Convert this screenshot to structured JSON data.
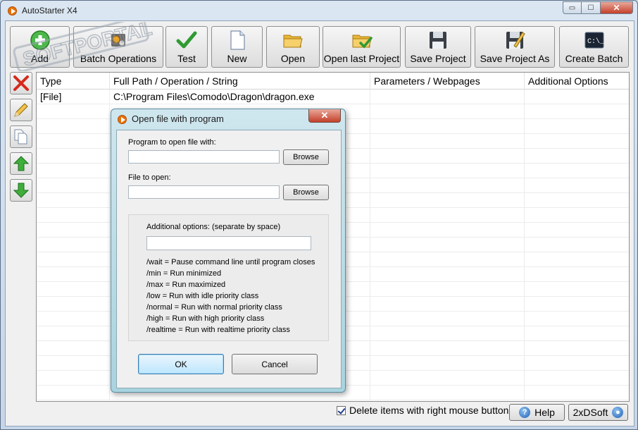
{
  "window": {
    "title": "AutoStarter X4",
    "minimize_glyph": "▭",
    "maximize_glyph": "☐",
    "close_glyph": "✕"
  },
  "toolbar": {
    "items": [
      {
        "label": "Add",
        "icon": "add-icon"
      },
      {
        "label": "Batch Operations",
        "icon": "batch-operations-icon"
      },
      {
        "label": "Test",
        "icon": "checkmark-icon"
      },
      {
        "label": "New",
        "icon": "new-document-icon"
      },
      {
        "label": "Open",
        "icon": "folder-open-icon"
      },
      {
        "label": "Open last Project",
        "icon": "folder-check-icon"
      },
      {
        "label": "Save Project",
        "icon": "floppy-disk-icon"
      },
      {
        "label": "Save Project As",
        "icon": "floppy-disk-pencil-icon"
      },
      {
        "label": "Create Batch",
        "icon": "command-prompt-icon"
      }
    ]
  },
  "sidebar": {
    "buttons": [
      "delete-icon",
      "edit-pencil-icon",
      "copy-icon",
      "move-up-icon",
      "move-down-icon"
    ]
  },
  "grid": {
    "columns": [
      "Type",
      "Full Path / Operation / String",
      "Parameters / Webpages",
      "Additional Options"
    ],
    "rows": [
      [
        "[File]",
        "C:\\Program Files\\Comodo\\Dragon\\dragon.exe",
        "",
        ""
      ]
    ]
  },
  "footer": {
    "delete_checkbox_label": "Delete items with right mouse button?",
    "delete_checkbox_checked": true,
    "help_label": "Help",
    "brand_label": "2xDSoft"
  },
  "dialog": {
    "title": "Open file with program",
    "close_glyph": "✕",
    "program_label": "Program to open file with:",
    "program_value": "",
    "browse_label": "Browse",
    "file_label": "File to open:",
    "file_value": "",
    "options_label": "Additional options: (separate by space)",
    "options_value": "",
    "option_help": [
      "/wait = Pause command line until program closes",
      "/min = Run minimized",
      "/max = Run maximized",
      "/low = Run with idle priority class",
      "/normal = Run with normal priority class",
      "/high = Run with high priority class",
      "/realtime = Run with realtime priority class"
    ],
    "ok_label": "OK",
    "cancel_label": "Cancel"
  },
  "watermark": {
    "text": "SOFTPORTAL",
    "tm": "TM"
  }
}
